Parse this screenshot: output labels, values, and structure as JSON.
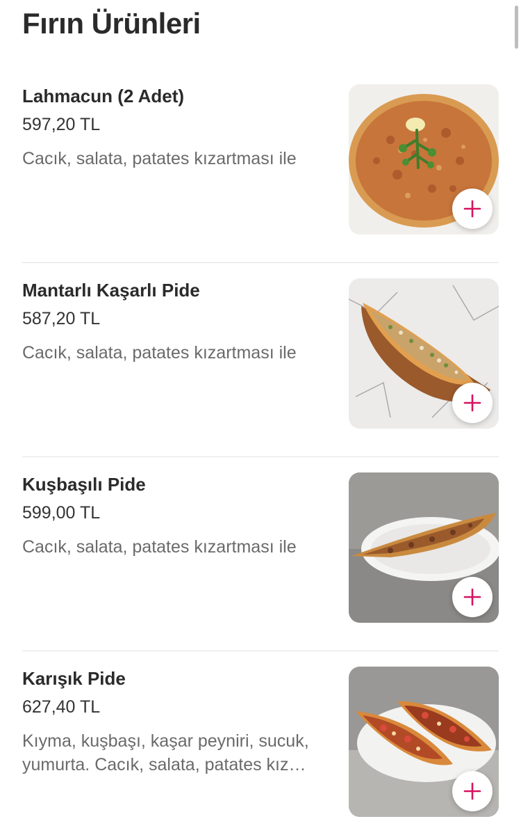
{
  "section": {
    "title": "Fırın Ürünleri"
  },
  "items": [
    {
      "name": "Lahmacun (2 Adet)",
      "price": "597,20 TL",
      "description": "Cacık, salata, patates kızartması ile"
    },
    {
      "name": "Mantarlı Kaşarlı Pide",
      "price": "587,20 TL",
      "description": "Cacık, salata, patates kızartması ile"
    },
    {
      "name": "Kuşbaşılı Pide",
      "price": "599,00 TL",
      "description": "Cacık, salata, patates kızartması ile"
    },
    {
      "name": "Karışık Pide",
      "price": "627,40 TL",
      "description": "Kıyma, kuşbaşı, kaşar peyniri, sucuk, yumurta. Cacık, salata, patates kız…"
    }
  ],
  "icons": {
    "add": "plus-icon"
  },
  "colors": {
    "accent": "#d6125f",
    "divider": "#e2e2e2"
  }
}
